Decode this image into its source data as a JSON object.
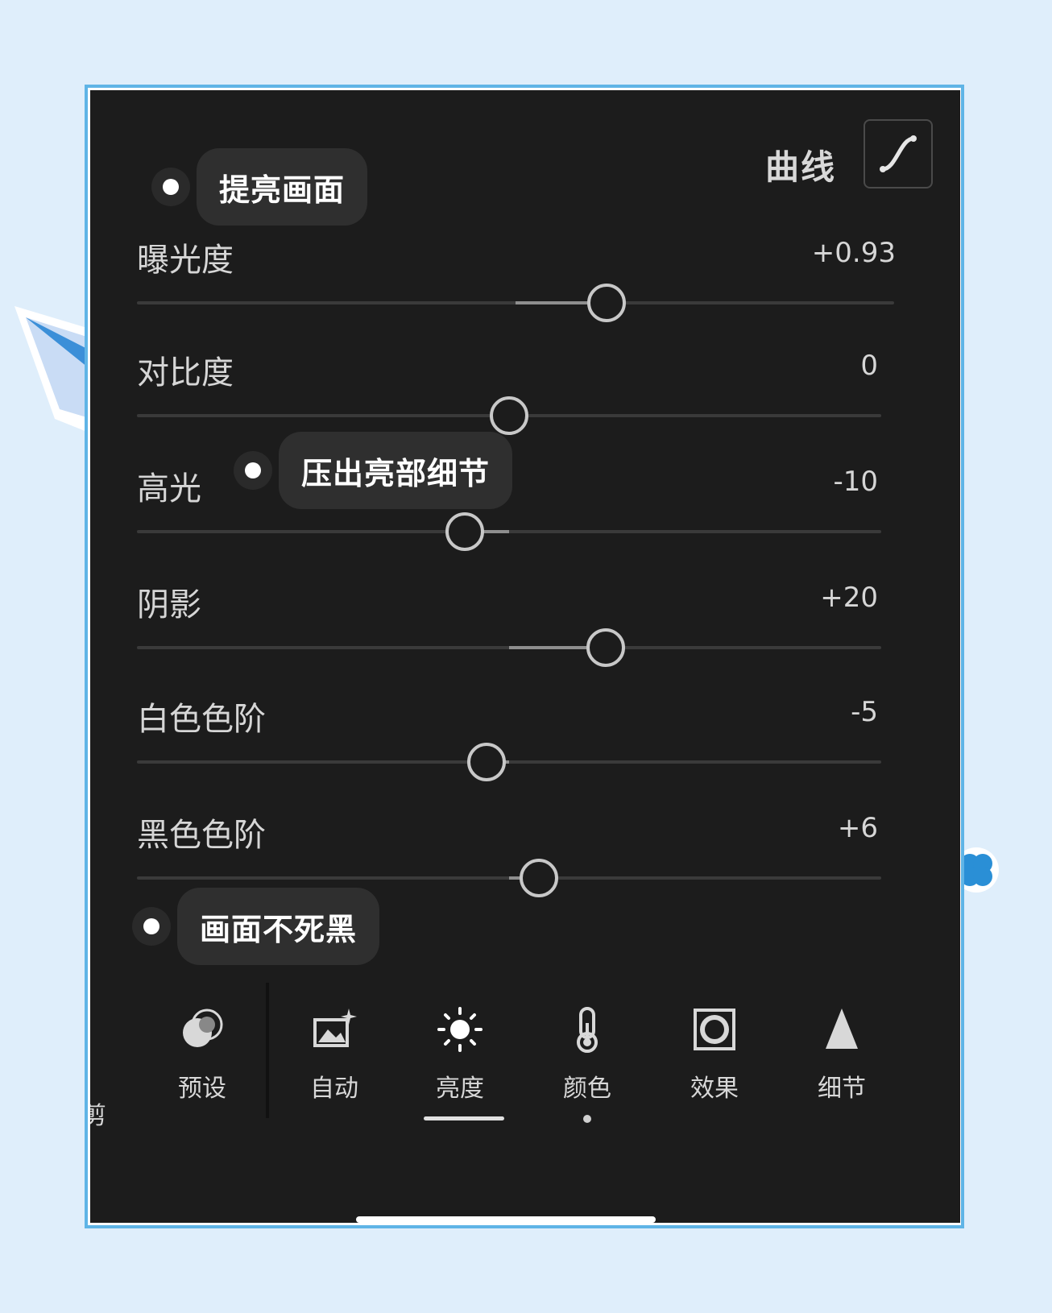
{
  "header": {
    "curve_label": "曲线",
    "curve_icon": "curve-icon"
  },
  "callouts": {
    "top": "提亮画面",
    "middle": "压出亮部细节",
    "bottom": "画面不死黑"
  },
  "sliders": [
    {
      "label": "曝光度",
      "value": "+0.93",
      "position": 0.62
    },
    {
      "label": "对比度",
      "value": "0",
      "position": 0.5
    },
    {
      "label": "高光",
      "value": "-10",
      "position": 0.44
    },
    {
      "label": "阴影",
      "value": "+20",
      "position": 0.63
    },
    {
      "label": "白色色阶",
      "value": "-5",
      "position": 0.47
    },
    {
      "label": "黑色色阶",
      "value": "+6",
      "position": 0.54
    }
  ],
  "nav": {
    "cut_label": "剪",
    "items": [
      {
        "label": "预设",
        "icon": "presets-icon"
      },
      {
        "label": "自动",
        "icon": "auto-icon"
      },
      {
        "label": "亮度",
        "icon": "brightness-icon",
        "active": true
      },
      {
        "label": "颜色",
        "icon": "color-temperature-icon"
      },
      {
        "label": "效果",
        "icon": "effects-icon"
      },
      {
        "label": "细节",
        "icon": "detail-icon"
      }
    ]
  },
  "colors": {
    "frame": "#5fb4e6",
    "panel": "#1c1c1c",
    "background": "#dfeefb"
  }
}
